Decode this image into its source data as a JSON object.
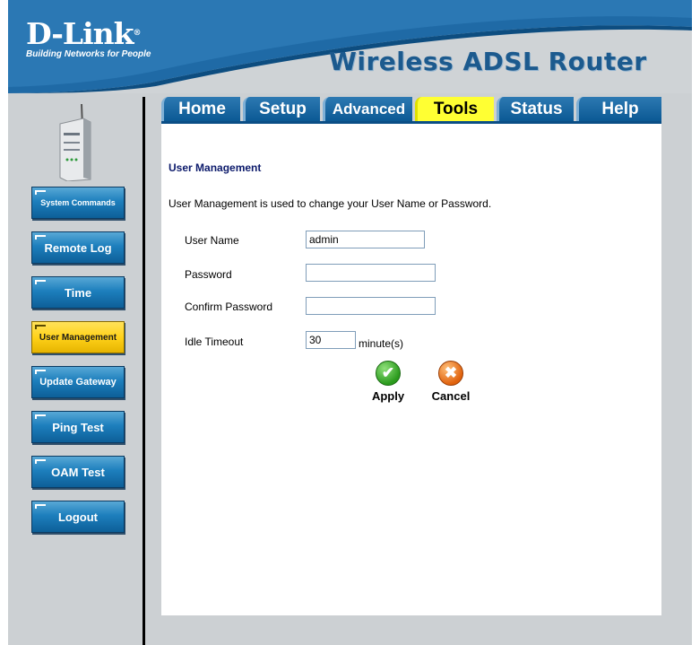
{
  "header": {
    "brand_logo": "D-Link",
    "brand_reg": "®",
    "brand_tagline": "Building Networks for People",
    "product_title": "Wireless ADSL Router"
  },
  "tabs": [
    {
      "label": "Home"
    },
    {
      "label": "Setup"
    },
    {
      "label": "Advanced"
    },
    {
      "label": "Tools",
      "active": true
    },
    {
      "label": "Status"
    },
    {
      "label": "Help"
    }
  ],
  "sidebar": {
    "items": [
      {
        "label": "System Commands"
      },
      {
        "label": "Remote Log"
      },
      {
        "label": "Time"
      },
      {
        "label": "User Management",
        "active": true
      },
      {
        "label": "Update Gateway"
      },
      {
        "label": "Ping Test"
      },
      {
        "label": "OAM Test"
      },
      {
        "label": "Logout"
      }
    ]
  },
  "main": {
    "section_title": "User Management",
    "description": "User Management is used to change your User Name or Password.",
    "fields": {
      "username": {
        "label": "User Name",
        "value": "admin"
      },
      "password": {
        "label": "Password",
        "value": ""
      },
      "confirm_password": {
        "label": "Confirm Password",
        "value": ""
      },
      "idle_timeout": {
        "label": "Idle Timeout",
        "value": "30",
        "unit": "minute(s)"
      }
    },
    "apply_label": "Apply",
    "cancel_label": "Cancel"
  },
  "colors": {
    "tab_blue": "#0b5994",
    "tab_active": "#ffff33",
    "sidebar_active": "#ffd21a",
    "title_blue": "#1c5a8e",
    "header_band": "#1f6aa6"
  }
}
